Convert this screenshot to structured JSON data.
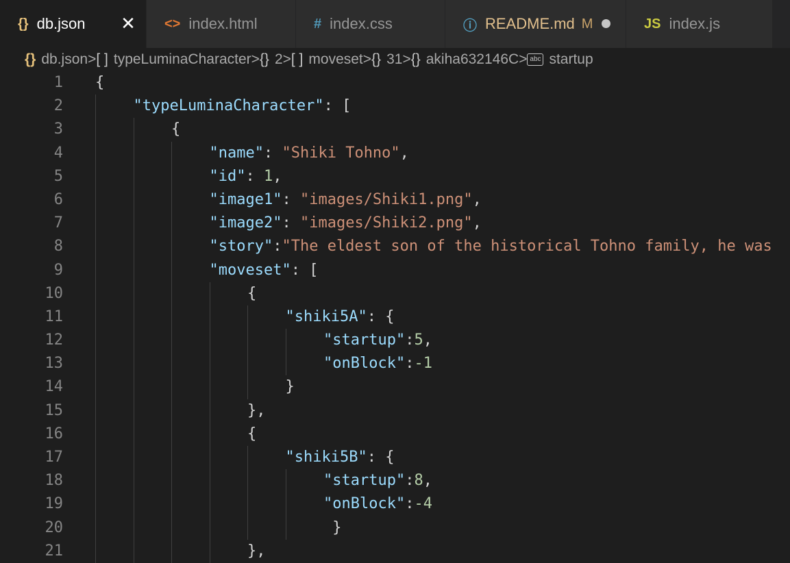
{
  "tabs": [
    {
      "icon": "{}",
      "icon_name": "json-braces-icon",
      "icon_color": "#e5c07b",
      "label": "db.json",
      "active": true,
      "close": "✕",
      "width": 214
    },
    {
      "icon": "<>",
      "icon_name": "html-icon",
      "icon_color": "#e37933",
      "label": "index.html",
      "width": 218
    },
    {
      "icon": "#",
      "icon_name": "css-hash-icon",
      "icon_color": "#519aba",
      "label": "index.css",
      "width": 218
    },
    {
      "icon": "ⓘ",
      "icon_name": "info-icon",
      "icon_color": "#519aba",
      "label": "README.md",
      "modified": "M",
      "dirty": true,
      "width": 264,
      "label_color": "#e2c08d"
    },
    {
      "icon": "JS",
      "icon_name": "javascript-icon",
      "icon_color": "#cbcb41",
      "label": "index.js",
      "width": 214
    }
  ],
  "breadcrumb": [
    {
      "icon": "{}",
      "icon_name": "json-braces-icon",
      "label": "db.json"
    },
    {
      "icon": "[ ]",
      "icon_name": "array-icon",
      "label": "typeLuminaCharacter"
    },
    {
      "icon": "{}",
      "icon_name": "object-icon",
      "label": "2"
    },
    {
      "icon": "[ ]",
      "icon_name": "array-icon",
      "label": "moveset"
    },
    {
      "icon": "{}",
      "icon_name": "object-icon",
      "label": "31"
    },
    {
      "icon": "{}",
      "icon_name": "object-icon",
      "label": "akiha632146C"
    },
    {
      "icon": "abc",
      "icon_name": "string-icon",
      "label": "startup"
    }
  ],
  "breadcrumb_separator": ">",
  "lines": [
    {
      "n": "1",
      "indent": 0,
      "tokens": [
        [
          "p",
          "{"
        ]
      ]
    },
    {
      "n": "2",
      "indent": 1,
      "tokens": [
        [
          "k",
          "\"typeLuminaCharacter\""
        ],
        [
          "p",
          ": ["
        ]
      ]
    },
    {
      "n": "3",
      "indent": 2,
      "tokens": [
        [
          "p",
          "{"
        ]
      ]
    },
    {
      "n": "4",
      "indent": 3,
      "tokens": [
        [
          "k",
          "\"name\""
        ],
        [
          "p",
          ": "
        ],
        [
          "s",
          "\"Shiki Tohno\""
        ],
        [
          "p",
          ","
        ]
      ]
    },
    {
      "n": "5",
      "indent": 3,
      "tokens": [
        [
          "k",
          "\"id\""
        ],
        [
          "p",
          ": "
        ],
        [
          "n",
          "1"
        ],
        [
          "p",
          ","
        ]
      ]
    },
    {
      "n": "6",
      "indent": 3,
      "tokens": [
        [
          "k",
          "\"image1\""
        ],
        [
          "p",
          ": "
        ],
        [
          "s",
          "\"images/Shiki1.png\""
        ],
        [
          "p",
          ","
        ]
      ]
    },
    {
      "n": "7",
      "indent": 3,
      "tokens": [
        [
          "k",
          "\"image2\""
        ],
        [
          "p",
          ": "
        ],
        [
          "s",
          "\"images/Shiki2.png\""
        ],
        [
          "p",
          ","
        ]
      ]
    },
    {
      "n": "8",
      "indent": 3,
      "tokens": [
        [
          "k",
          "\"story\""
        ],
        [
          "p",
          ":"
        ],
        [
          "s",
          "\"The eldest son of the historical Tohno family, he was"
        ]
      ]
    },
    {
      "n": "9",
      "indent": 3,
      "tokens": [
        [
          "k",
          "\"moveset\""
        ],
        [
          "p",
          ": ["
        ]
      ]
    },
    {
      "n": "10",
      "indent": 4,
      "tokens": [
        [
          "p",
          "{"
        ]
      ]
    },
    {
      "n": "11",
      "indent": 5,
      "tokens": [
        [
          "k",
          "\"shiki5A\""
        ],
        [
          "p",
          ": {"
        ]
      ]
    },
    {
      "n": "12",
      "indent": 6,
      "tokens": [
        [
          "k",
          "\"startup\""
        ],
        [
          "p",
          ":"
        ],
        [
          "n",
          "5"
        ],
        [
          "p",
          ","
        ]
      ]
    },
    {
      "n": "13",
      "indent": 6,
      "tokens": [
        [
          "k",
          "\"onBlock\""
        ],
        [
          "p",
          ":"
        ],
        [
          "n",
          "-1"
        ]
      ]
    },
    {
      "n": "14",
      "indent": 5,
      "tokens": [
        [
          "p",
          "}"
        ]
      ]
    },
    {
      "n": "15",
      "indent": 4,
      "tokens": [
        [
          "p",
          "},"
        ]
      ]
    },
    {
      "n": "16",
      "indent": 4,
      "tokens": [
        [
          "p",
          "{"
        ]
      ]
    },
    {
      "n": "17",
      "indent": 5,
      "tokens": [
        [
          "k",
          "\"shiki5B\""
        ],
        [
          "p",
          ": {"
        ]
      ]
    },
    {
      "n": "18",
      "indent": 6,
      "tokens": [
        [
          "k",
          "\"startup\""
        ],
        [
          "p",
          ":"
        ],
        [
          "n",
          "8"
        ],
        [
          "p",
          ","
        ]
      ]
    },
    {
      "n": "19",
      "indent": 6,
      "tokens": [
        [
          "k",
          "\"onBlock\""
        ],
        [
          "p",
          ":"
        ],
        [
          "n",
          "-4"
        ]
      ]
    },
    {
      "n": "20",
      "indent": 6,
      "tokens": [
        [
          "p",
          " }"
        ]
      ]
    },
    {
      "n": "21",
      "indent": 4,
      "tokens": [
        [
          "p",
          "},"
        ]
      ]
    }
  ],
  "colors": {
    "key": "#9cdcfe",
    "string": "#ce9178",
    "number": "#b5cea8",
    "punctuation": "#d4d4d4",
    "background": "#1e1e1e"
  }
}
